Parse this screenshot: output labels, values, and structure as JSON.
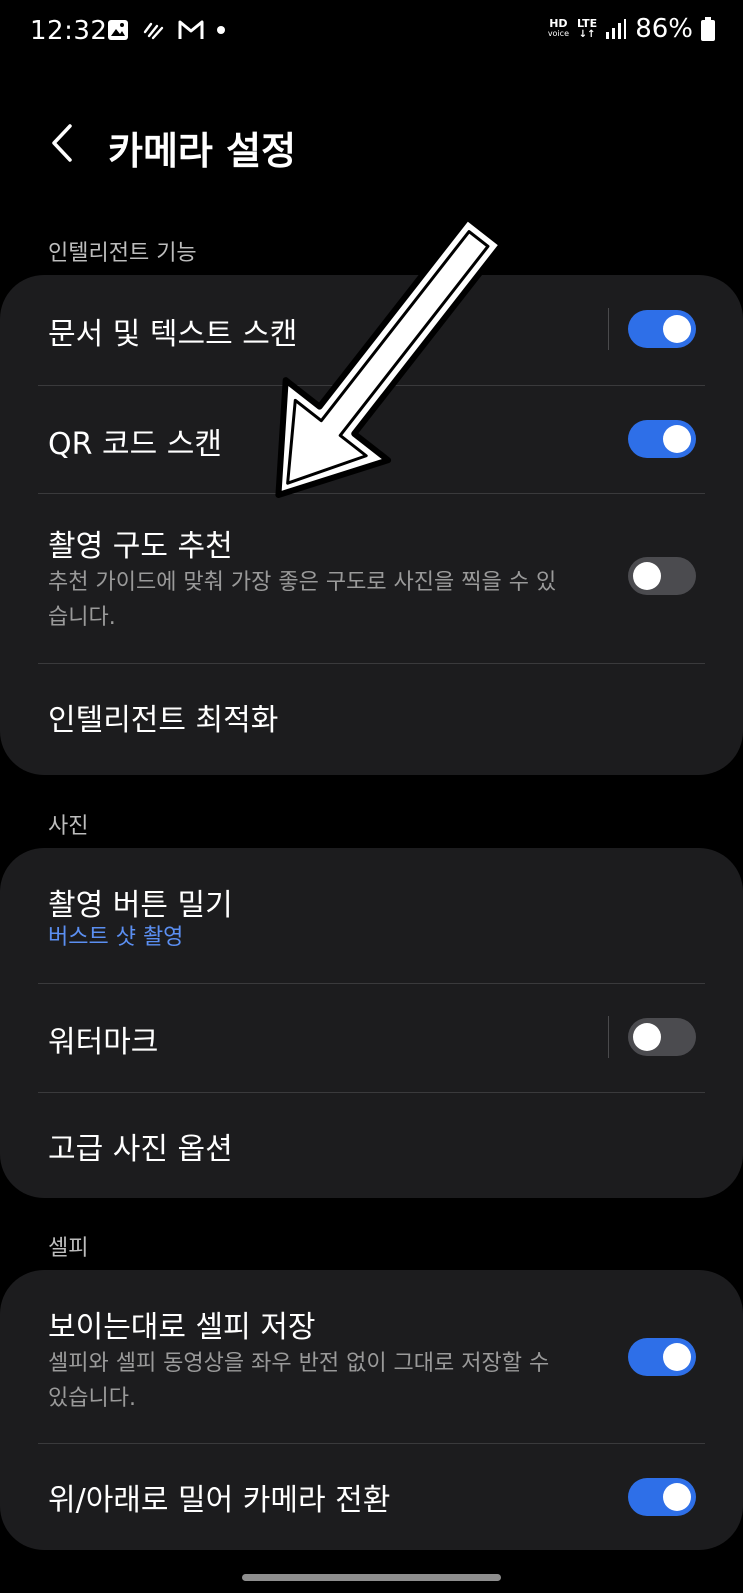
{
  "status_bar": {
    "time": "12:32",
    "hd_top": "HD",
    "hd_bottom": "voice",
    "lte": "LTE",
    "battery": "86%"
  },
  "header": {
    "title": "카메라 설정"
  },
  "sections": {
    "intelligent": {
      "label": "인텔리전트 기능",
      "doc_scan": {
        "title": "문서 및 텍스트 스캔",
        "enabled": true
      },
      "qr_scan": {
        "title": "QR 코드 스캔",
        "enabled": true
      },
      "shot_suggestions": {
        "title": "촬영 구도 추천",
        "subtitle": "추천 가이드에 맞춰 가장 좋은 구도로 사진을 찍을 수 있습니다.",
        "enabled": false
      },
      "optimization": {
        "title": "인텔리전트 최적화"
      }
    },
    "photo": {
      "label": "사진",
      "swipe_shutter": {
        "title": "촬영 버튼 밀기",
        "subtitle": "버스트 샷 촬영"
      },
      "watermark": {
        "title": "워터마크",
        "enabled": false
      },
      "advanced": {
        "title": "고급 사진 옵션"
      }
    },
    "selfie": {
      "label": "셀피",
      "save_as_previewed": {
        "title": "보이는대로 셀피 저장",
        "subtitle": "셀피와 셀피 동영상을 좌우 반전 없이 그대로 저장할 수 있습니다.",
        "enabled": true
      },
      "swipe_switch": {
        "title": "위/아래로 밀어 카메라 전환",
        "enabled": true
      }
    }
  },
  "colors": {
    "accent": "#2e6fe8",
    "link": "#5b8ff2",
    "card": "#1c1c1e",
    "background": "#000000"
  }
}
